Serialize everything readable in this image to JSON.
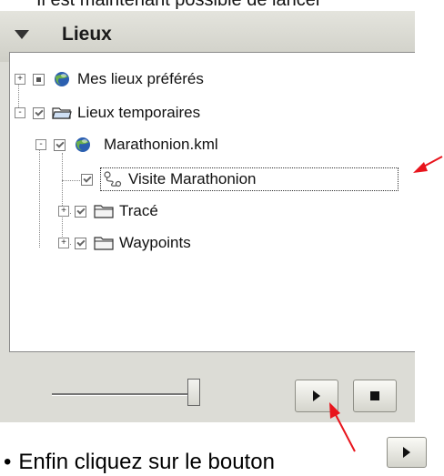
{
  "top_text": "Il est maintenant possible de lancer",
  "panel": {
    "title": "Lieux",
    "collapse_icon": "triangle-down-icon"
  },
  "tree": {
    "items": [
      {
        "label": "Mes lieux préférés",
        "expander": "+",
        "checkbox": "partial",
        "icon": "globe-icon"
      },
      {
        "label": "Lieux temporaires",
        "expander": "-",
        "checkbox": "checked",
        "icon": "folder-open-icon"
      },
      {
        "label": "Marathonion.kml",
        "expander": "-",
        "checkbox": "checked",
        "icon": "globe-icon"
      },
      {
        "label": "Visite Marathonion",
        "expander": "",
        "checkbox": "checked",
        "icon": "tour-path-icon",
        "selected": true
      },
      {
        "label": "Tracé",
        "expander": "+",
        "checkbox": "checked",
        "icon": "folder-icon"
      },
      {
        "label": "Waypoints",
        "expander": "+",
        "checkbox": "checked",
        "icon": "folder-icon"
      }
    ]
  },
  "controls": {
    "play_icon": "play-icon",
    "stop_icon": "stop-icon",
    "slider_icon": "slider-thumb-icon"
  },
  "bottom_text": "Enfin cliquez sur le bouton",
  "bullet": "•",
  "annotation_color": "#e8141c"
}
